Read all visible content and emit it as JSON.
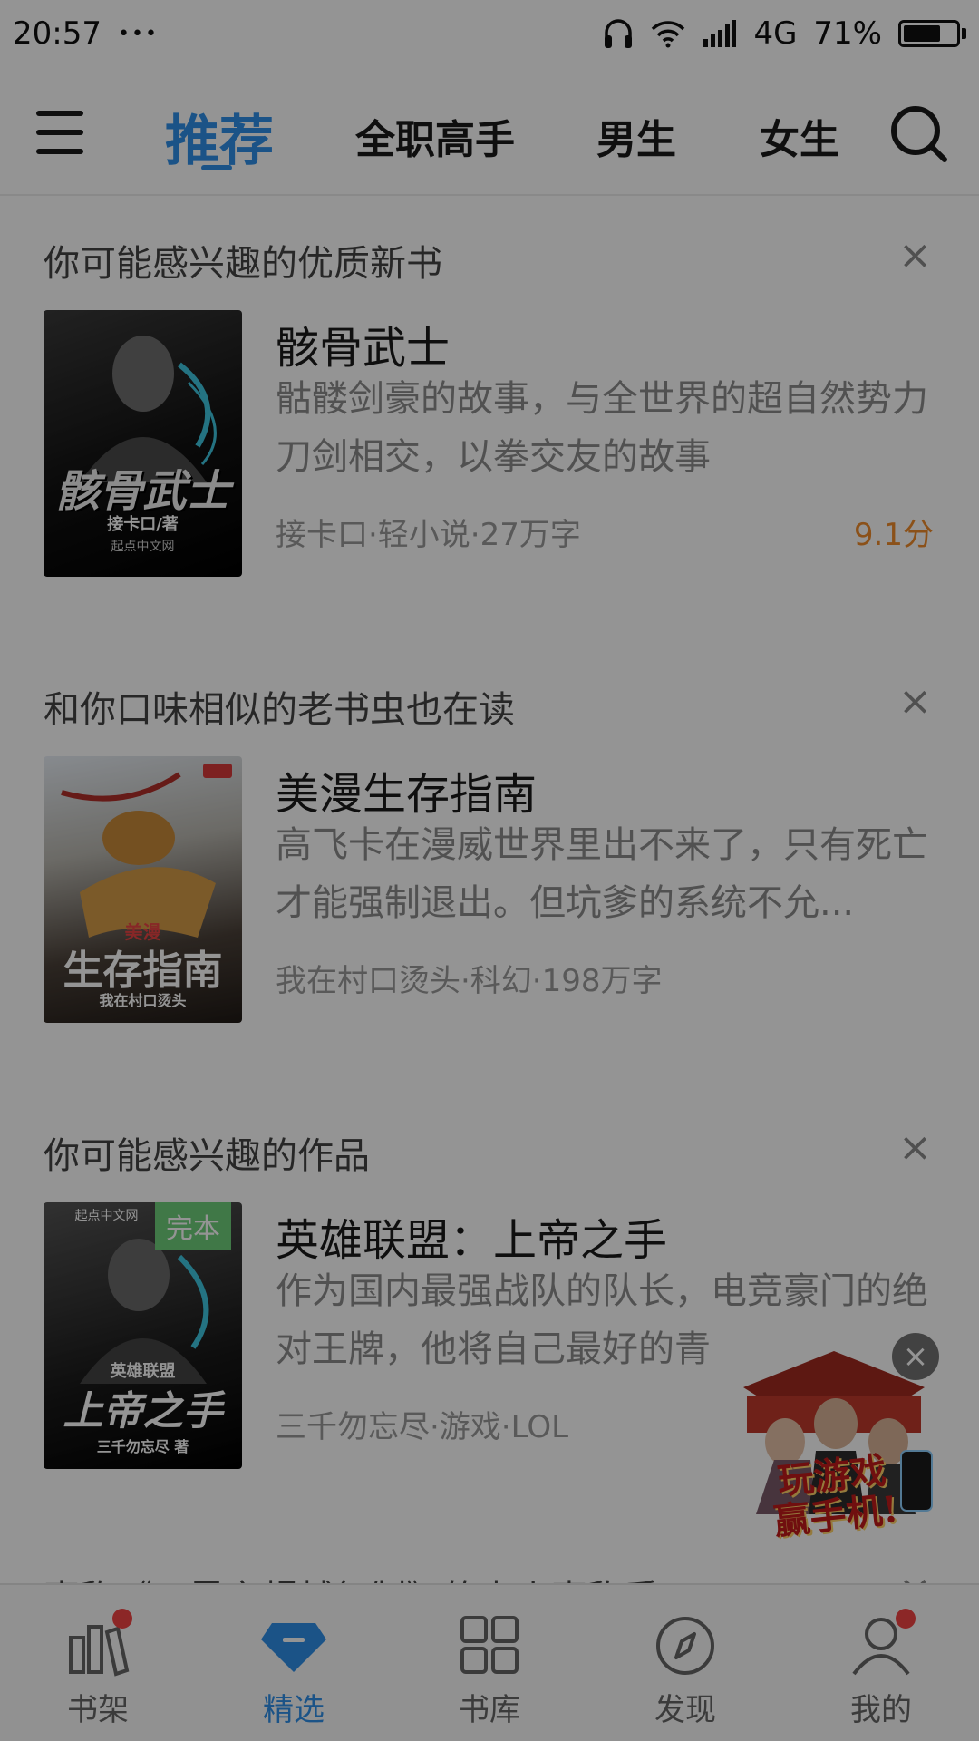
{
  "status_bar": {
    "time": "20:57",
    "dots": "•••",
    "network": "4G",
    "battery_pct": "71%",
    "battery_level": 0.71
  },
  "top_nav": {
    "tabs": [
      {
        "label": "推荐",
        "active": true
      },
      {
        "label": "全职高手",
        "active": false
      },
      {
        "label": "男生",
        "active": false
      },
      {
        "label": "女生",
        "active": false
      }
    ]
  },
  "feed": {
    "sections": [
      {
        "header": "你可能感兴趣的优质新书",
        "close": "×",
        "book": {
          "title": "骸骨武士",
          "description": "骷髅剑豪的故事，与全世界的超自然势力刀剑相交，以拳交友的故事",
          "meta": "接卡口·轻小说·27万字",
          "score": "9.1分",
          "cover_title": "骸骨武士",
          "cover_author": "接卡口/著",
          "cover_publisher": "起点中文网"
        }
      },
      {
        "header": "和你口味相似的老书虫也在读",
        "close": "×",
        "book": {
          "title": "美漫生存指南",
          "description": "高飞卡在漫威世界里出不来了，只有死亡才能强制退出。但坑爹的系统不允...",
          "meta": "我在村口烫头·科幻·198万字",
          "cover_title_top": "美漫",
          "cover_title": "生存指南",
          "cover_author": "我在村口烫头"
        }
      },
      {
        "header": "你可能感兴趣的作品",
        "close": "×",
        "book": {
          "title": "英雄联盟：上帝之手",
          "description": "作为国内最强战队的队长，电竞豪门的绝对王牌，他将自己最好的青",
          "meta": "三千勿忘尽·游戏·LOL",
          "badge": "完本",
          "cover_publisher": "起点中文网",
          "cover_title_top": "英雄联盟",
          "cover_title": "上帝之手",
          "cover_author": "三千勿忘尽 著"
        }
      }
    ],
    "partial_header": "声称《三界之超越复制》的少小声称手",
    "partial_close": "×"
  },
  "promo": {
    "close": "×",
    "text_line1": "玩游戏",
    "text_line2": "赢手机!"
  },
  "bottom_nav": {
    "items": [
      {
        "label": "书架",
        "icon": "bookshelf-icon",
        "badge": true
      },
      {
        "label": "精选",
        "icon": "diamond-icon",
        "active": true
      },
      {
        "label": "书库",
        "icon": "grid-icon"
      },
      {
        "label": "发现",
        "icon": "compass-icon"
      },
      {
        "label": "我的",
        "icon": "person-icon",
        "badge": true
      }
    ]
  },
  "colors": {
    "accent": "#2f8fe8",
    "score": "#f08c2c",
    "badge_red": "#f24444",
    "complete_badge": "#6fcf7a"
  }
}
